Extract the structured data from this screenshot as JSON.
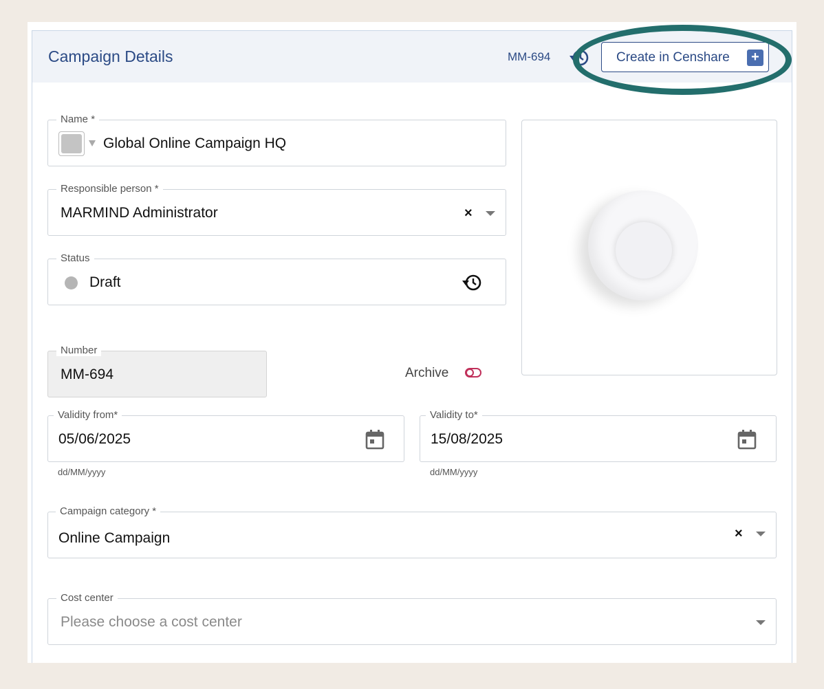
{
  "header": {
    "title": "Campaign Details",
    "number": "MM-694",
    "history_icon": "history-icon",
    "censhare_button_label": "Create in Censhare",
    "censhare_button_icon": "plus-icon",
    "highlight_color": "#236e6c"
  },
  "form": {
    "name": {
      "label": "Name",
      "required_mark": "*",
      "value": "Global Online Campaign HQ",
      "color_swatch": "#c4c4c4"
    },
    "responsible": {
      "label": "Responsible person",
      "required_mark": "*",
      "value": "MARMIND Administrator"
    },
    "status": {
      "label": "Status",
      "value": "Draft",
      "dot_color": "#b5b5b5",
      "icon": "history-icon"
    },
    "number": {
      "label": "Number",
      "value": "MM-694"
    },
    "archive": {
      "label": "Archive",
      "state": "off"
    },
    "validity_from": {
      "label": "Validity from*",
      "value": "05/06/2025",
      "hint": "dd/MM/yyyy"
    },
    "validity_to": {
      "label": "Validity to*",
      "value": "15/08/2025",
      "hint": "dd/MM/yyyy"
    },
    "category": {
      "label": "Campaign category *",
      "value": "Online Campaign"
    },
    "cost_center": {
      "label": "Cost center",
      "placeholder": "Please choose a cost center"
    }
  },
  "image_panel": {
    "state": "loading"
  },
  "colors": {
    "accent": "#2b4a85",
    "page_bg": "#f1ebe4",
    "header_bg": "#f0f3f8"
  }
}
